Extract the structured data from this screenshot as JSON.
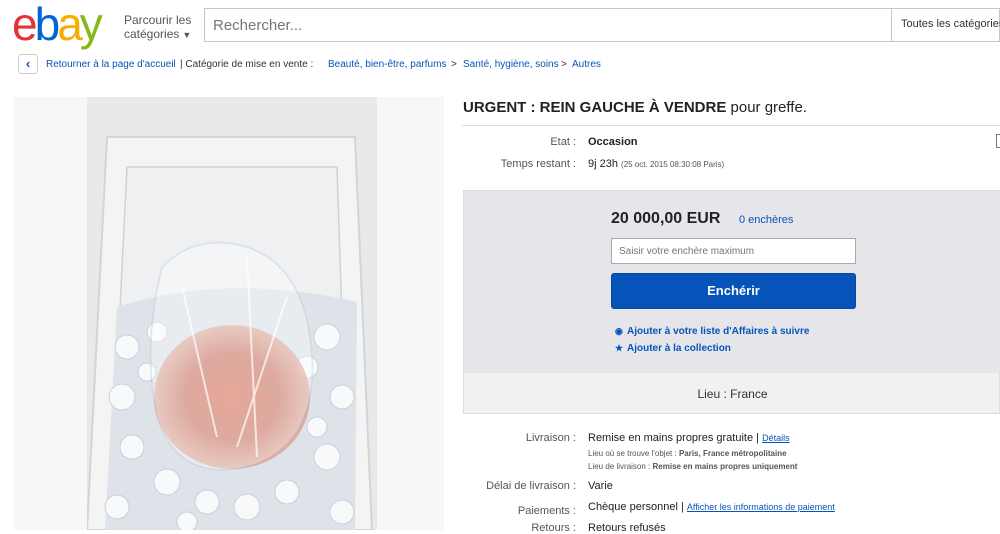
{
  "header": {
    "browse_line1": "Parcourir les",
    "browse_line2": "catégories",
    "search_placeholder": "Rechercher...",
    "search_category": "Toutes les catégories"
  },
  "breadcrumb": {
    "back_label": "Retourner à la page d'accueil",
    "category_prefix": "| Catégorie de mise en vente :",
    "items": [
      "Beauté, bien-être, parfums",
      "Santé, hygiène, soins",
      "Autres"
    ],
    "separator": ">"
  },
  "listing": {
    "title_bold": "URGENT : REIN GAUCHE À VENDRE",
    "title_rest": " pour greffe.",
    "etat_label": "Etat :",
    "etat_value": "Occasion",
    "time_label": "Temps restant :",
    "time_value": "9j 23h",
    "time_detail": "(25 oct. 2015   08:30:08 Paris)"
  },
  "bid": {
    "price": "20 000,00 EUR",
    "bids_count": "0 enchères",
    "input_placeholder": "Saisir votre enchère maximum",
    "button_label": "Enchérir",
    "watch_label": "Ajouter à votre liste d'Affaires à suivre",
    "collection_label": "Ajouter à la collection",
    "lieu": "Lieu : France"
  },
  "shipping": {
    "livraison_label": "Livraison :",
    "livraison_value": "Remise en mains propres gratuite",
    "details_link": "Détails",
    "lieu_objet_label": "Lieu où se trouve l'objet :",
    "lieu_objet_value": "Paris, France métropolitaine",
    "lieu_livraison_label": "Lieu de livraison :",
    "lieu_livraison_value": "Remise en mains propres uniquement",
    "delai_label": "Délai de livraison :",
    "delai_value": "Varie",
    "paiements_label": "Paiements :",
    "paiements_value": "Chèque personnel",
    "paiements_link": "Afficher les informations de paiement",
    "retours_label": "Retours :",
    "retours_value": "Retours refusés"
  },
  "colors": {
    "brand_red": "#e53238",
    "brand_blue": "#0064d2",
    "brand_yellow": "#f5af02",
    "brand_green": "#86b817",
    "link": "#0654ba",
    "button": "#0654ba"
  }
}
